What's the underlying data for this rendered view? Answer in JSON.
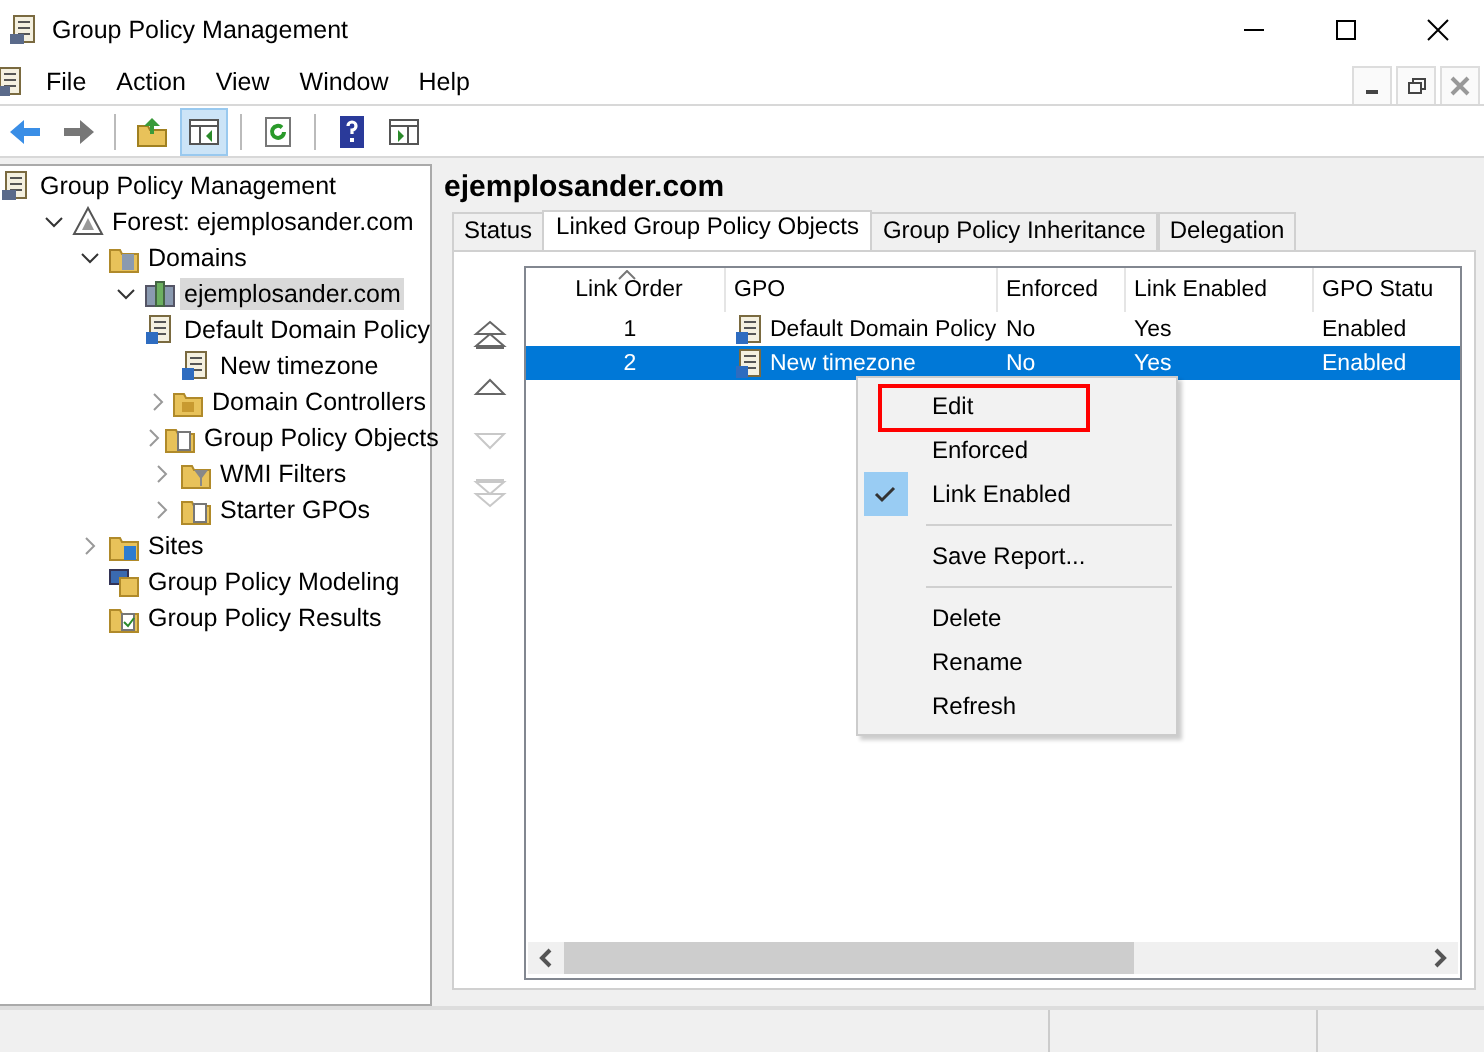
{
  "window": {
    "title": "Group Policy Management"
  },
  "menu_bar": [
    {
      "label": "File"
    },
    {
      "label": "Action"
    },
    {
      "label": "View"
    },
    {
      "label": "Window"
    },
    {
      "label": "Help"
    }
  ],
  "toolbar": [
    {
      "kind": "back",
      "pressed": false
    },
    {
      "kind": "forward",
      "pressed": false
    },
    {
      "kind": "sep"
    },
    {
      "kind": "folder-up",
      "pressed": false
    },
    {
      "kind": "tree-toggle",
      "pressed": true
    },
    {
      "kind": "sep"
    },
    {
      "kind": "refresh",
      "pressed": false
    },
    {
      "kind": "sep"
    },
    {
      "kind": "help",
      "pressed": false
    },
    {
      "kind": "panel",
      "pressed": false
    }
  ],
  "tree": [
    {
      "label": "Group Policy Management",
      "kind": "console",
      "selected": false,
      "children": [
        {
          "label": "Forest: ejemplosander.com",
          "kind": "forest",
          "expanded": true,
          "selected": false,
          "children": [
            {
              "label": "Domains",
              "kind": "domains",
              "expanded": true,
              "selected": false,
              "children": [
                {
                  "label": "ejemplosander.com",
                  "kind": "domain",
                  "expanded": true,
                  "selected": true,
                  "children": [
                    {
                      "label": "Default Domain Policy",
                      "kind": "gpo-link",
                      "selected": false
                    },
                    {
                      "label": "New timezone",
                      "kind": "gpo-link",
                      "selected": false
                    },
                    {
                      "label": "Domain Controllers",
                      "kind": "ou",
                      "expanded": false,
                      "selected": false
                    },
                    {
                      "label": "Group Policy Objects",
                      "kind": "folder-doc",
                      "expanded": false,
                      "selected": false
                    },
                    {
                      "label": "WMI Filters",
                      "kind": "folder-filter",
                      "expanded": false,
                      "selected": false
                    },
                    {
                      "label": "Starter GPOs",
                      "kind": "folder-doc",
                      "expanded": false,
                      "selected": false
                    }
                  ]
                }
              ]
            },
            {
              "label": "Sites",
              "kind": "sites",
              "expanded": false,
              "selected": false
            },
            {
              "label": "Group Policy Modeling",
              "kind": "modeling",
              "selected": false
            },
            {
              "label": "Group Policy Results",
              "kind": "results",
              "selected": false
            }
          ]
        }
      ]
    }
  ],
  "details": {
    "title": "ejemplosander.com",
    "tabs": [
      {
        "label": "Status",
        "selected": false
      },
      {
        "label": "Linked Group Policy Objects",
        "selected": true
      },
      {
        "label": "Group Policy Inheritance",
        "selected": false
      },
      {
        "label": "Delegation",
        "selected": false
      }
    ],
    "order_buttons": [
      {
        "kind": "top",
        "disabled": false
      },
      {
        "kind": "up",
        "disabled": false
      },
      {
        "kind": "down",
        "disabled": true
      },
      {
        "kind": "bottom",
        "disabled": true
      }
    ],
    "table": {
      "columns": [
        {
          "label": "Link Order",
          "sorted": true
        },
        {
          "label": "GPO",
          "sorted": false
        },
        {
          "label": "Enforced",
          "sorted": false
        },
        {
          "label": "Link Enabled",
          "sorted": false
        },
        {
          "label": "GPO Statu",
          "sorted": false
        }
      ],
      "rows": [
        {
          "cells": [
            "1",
            "Default Domain Policy",
            "No",
            "Yes",
            "Enabled"
          ],
          "selected": false
        },
        {
          "cells": [
            "2",
            "New timezone",
            "No",
            "Yes",
            "Enabled"
          ],
          "selected": true
        }
      ]
    }
  },
  "context_menu": [
    {
      "kind": "item",
      "label": "Edit",
      "checked": false,
      "highlighted": true
    },
    {
      "kind": "item",
      "label": "Enforced",
      "checked": false,
      "highlighted": false
    },
    {
      "kind": "item",
      "label": "Link Enabled",
      "checked": true,
      "highlighted": false
    },
    {
      "kind": "separator"
    },
    {
      "kind": "item",
      "label": "Save Report...",
      "checked": false,
      "highlighted": false
    },
    {
      "kind": "separator"
    },
    {
      "kind": "item",
      "label": "Delete",
      "checked": false,
      "highlighted": false
    },
    {
      "kind": "item",
      "label": "Rename",
      "checked": false,
      "highlighted": false
    },
    {
      "kind": "item",
      "label": "Refresh",
      "checked": false,
      "highlighted": false
    }
  ]
}
